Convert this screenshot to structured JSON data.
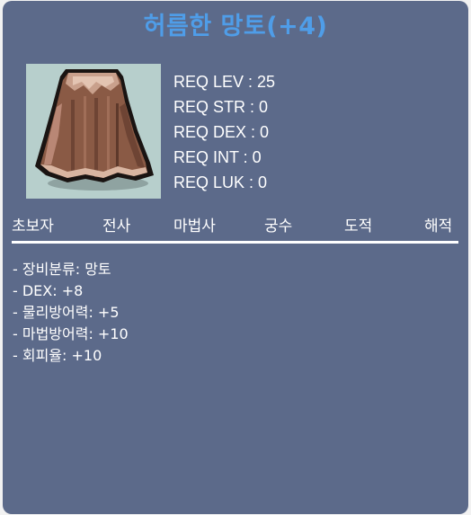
{
  "item": {
    "name": "허름한 망토(+4)",
    "title_color": "#4f9de8",
    "background_color": "#5c6a8a",
    "image_icon": "brown-cape-icon"
  },
  "requirements": [
    "REQ LEV : 25",
    "REQ STR : 0",
    "REQ DEX : 0",
    "REQ INT : 0",
    "REQ LUK : 0"
  ],
  "jobs": [
    "초보자",
    "전사",
    "마법사",
    "궁수",
    "도적",
    "해적"
  ],
  "stats": [
    "- 장비분류: 망토",
    "- DEX: +8",
    "- 물리방어력: +5",
    "- 마법방어력: +10",
    "- 회피율: +10"
  ]
}
